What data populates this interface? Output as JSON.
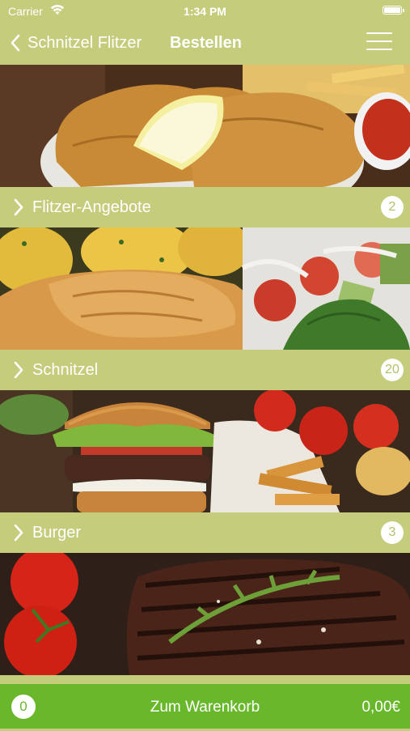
{
  "status_bar": {
    "carrier": "Carrier",
    "time": "1:34 PM"
  },
  "nav": {
    "back_label": "Schnitzel Flitzer",
    "title": "Bestellen"
  },
  "categories": [
    {
      "label": "Flitzer-Angebote",
      "count": "2",
      "image": "schnitzel-with-lemon-and-fries"
    },
    {
      "label": "Schnitzel",
      "count": "20",
      "image": "breaded-schnitzel-with-potatoes-and-salad"
    },
    {
      "label": "Burger",
      "count": "3",
      "image": "burger-with-fries-and-tomatoes"
    },
    {
      "label": "",
      "count": "",
      "image": "grilled-steak-with-tomatoes"
    }
  ],
  "cart": {
    "count": "0",
    "label": "Zum Warenkorb",
    "total": "0,00€"
  },
  "colors": {
    "header": "#c5cc7b",
    "cart_bar": "#69b82c",
    "badge_text": "#b7bf66"
  }
}
